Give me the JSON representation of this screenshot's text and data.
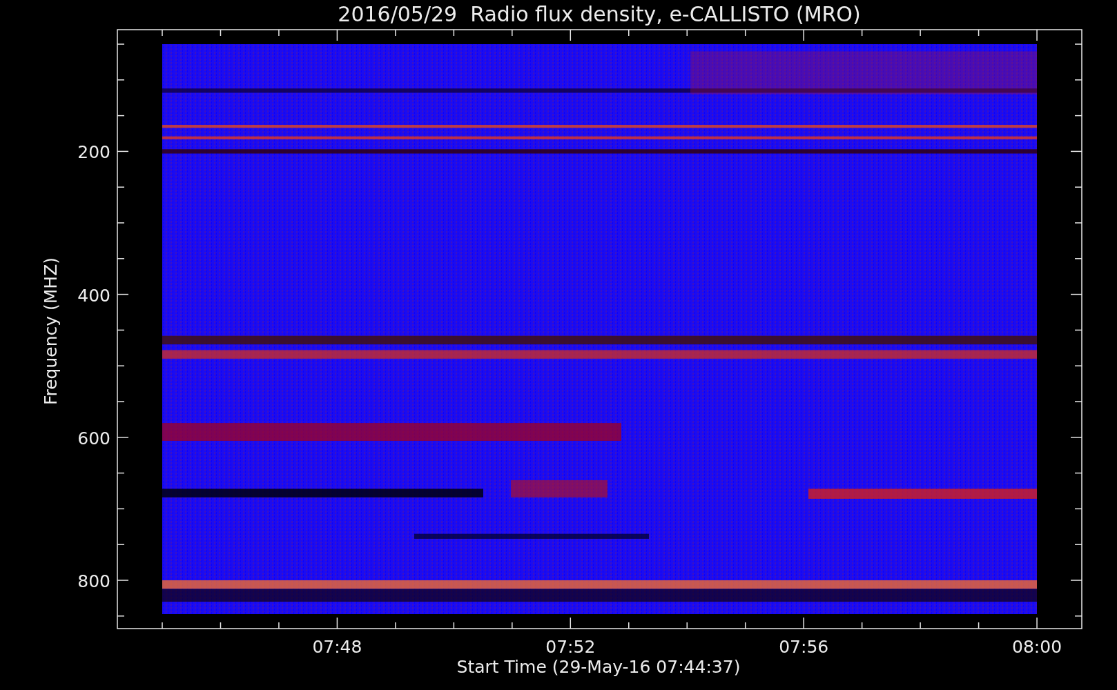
{
  "title": "2016/05/29  Radio flux density, e-CALLISTO (MRO)",
  "y_axis": {
    "label": "Frequency (MHZ)",
    "tick_labels": [
      "200",
      "400",
      "600",
      "800"
    ]
  },
  "x_axis": {
    "label": "Start Time (29-May-16 07:44:37)",
    "tick_labels": [
      "07:48",
      "07:52",
      "07:56",
      "08:00"
    ]
  }
}
